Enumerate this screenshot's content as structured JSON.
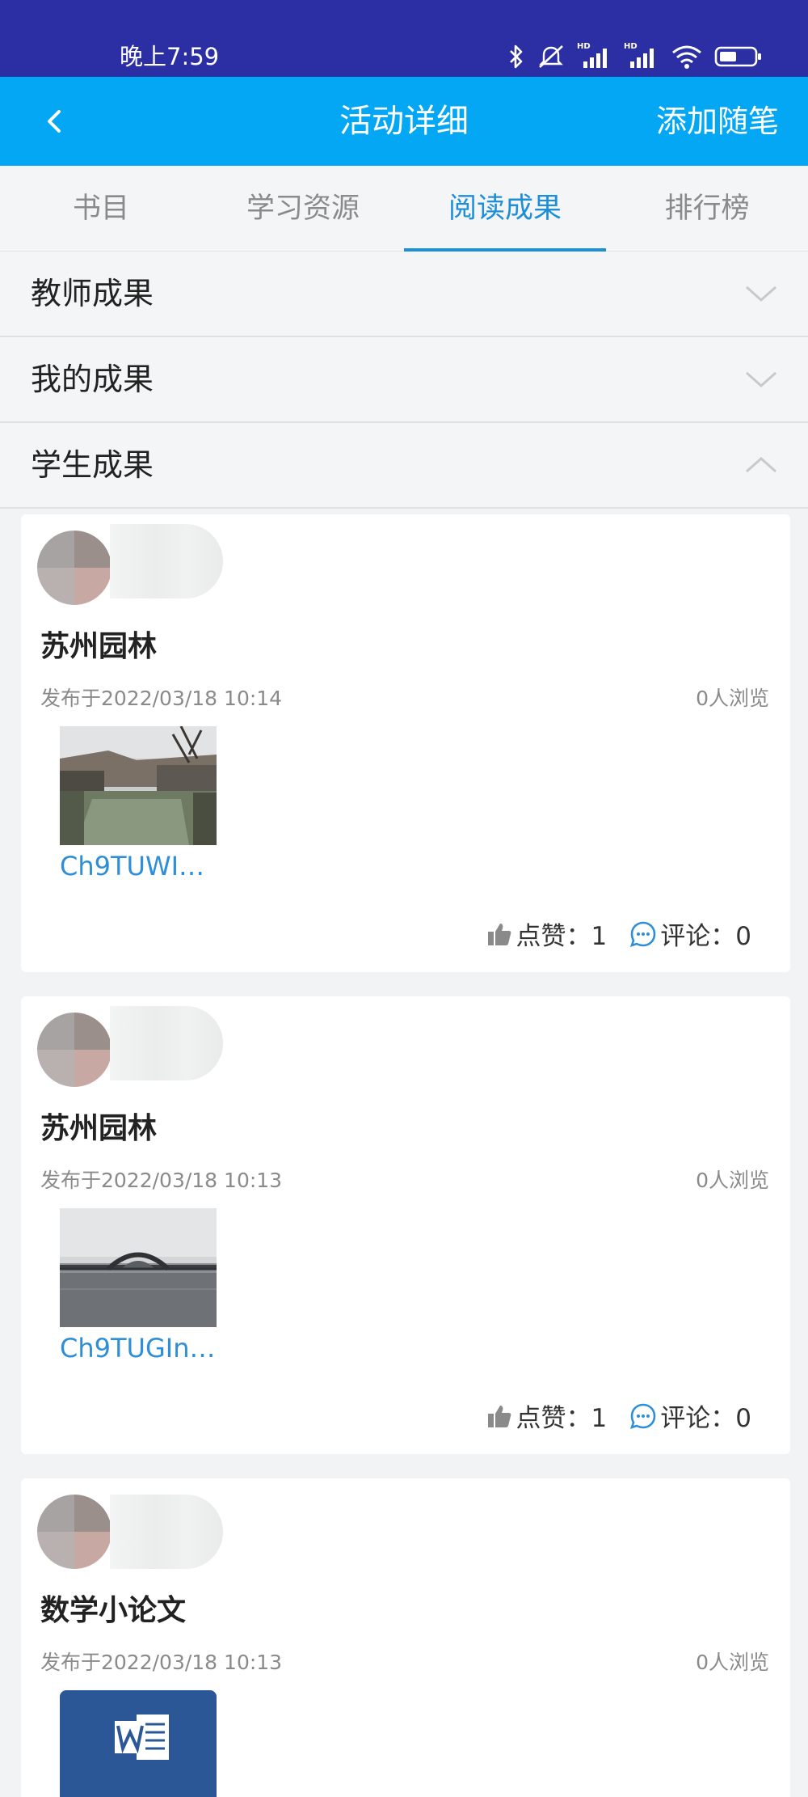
{
  "status_bar": {
    "time": "晚上7:59",
    "hd1": "HD",
    "hd2": "HD"
  },
  "header": {
    "title": "活动详细",
    "right_action": "添加随笔"
  },
  "tabs": [
    {
      "label": "书目",
      "active": false
    },
    {
      "label": "学习资源",
      "active": false
    },
    {
      "label": "阅读成果",
      "active": true
    },
    {
      "label": "排行榜",
      "active": false
    }
  ],
  "sections": [
    {
      "title": "教师成果",
      "expanded": false
    },
    {
      "title": "我的成果",
      "expanded": false
    },
    {
      "title": "学生成果",
      "expanded": true
    }
  ],
  "posts": [
    {
      "title": "苏州园林",
      "date": "发布于2022/03/18 10:14",
      "views": "0人浏览",
      "file_name": "Ch9TUWI…",
      "file_icon": "photo-thumbnail",
      "likes": "点赞：1",
      "comments": "评论：0"
    },
    {
      "title": "苏州园林",
      "date": "发布于2022/03/18 10:13",
      "views": "0人浏览",
      "file_name": "Ch9TUGIn…",
      "file_icon": "photo-thumbnail",
      "likes": "点赞：1",
      "comments": "评论：0"
    },
    {
      "title": "数学小论文",
      "date": "发布于2022/03/18 10:13",
      "views": "0人浏览",
      "file_icon": "word-doc-icon"
    }
  ],
  "colors": {
    "status_bar": "#2b2fa3",
    "app_bar": "#03a7f3",
    "tab_active": "#1e8fd6",
    "link": "#2e8ed7"
  }
}
